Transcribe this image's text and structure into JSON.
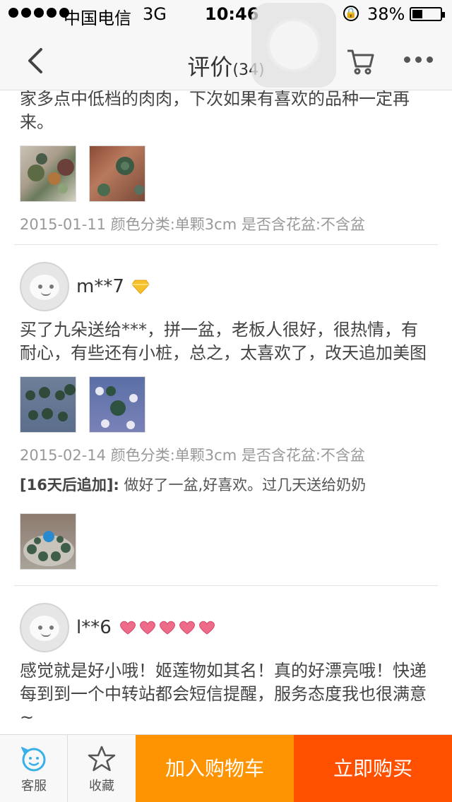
{
  "status_bar": {
    "carrier": "中国电信",
    "network": "3G",
    "time": "10:46",
    "battery_percent": "38%",
    "battery_level": 0.38
  },
  "nav": {
    "title": "评价",
    "count": "(34)"
  },
  "reviews": [
    {
      "text": "家多点中低档的肉肉，下次如果有喜欢的品种一定再来。",
      "meta": "2015-01-11 颜色分类:单颗3cm 是否含花盆:不含盆"
    },
    {
      "username": "m**7",
      "text": "买了九朵送给***，拼一盆，老板人很好，很热情，有耐心，有些还有小桩，总之，太喜欢了，改天追加美图",
      "meta": "2015-02-14 颜色分类:单颗3cm 是否含花盆:不含盆",
      "append_tag": "[16天后追加]:",
      "append_text": " 做好了一盆,好喜欢。过几天送给奶奶"
    },
    {
      "username": "l**6",
      "text": "感觉就是好小哦！姬莲物如其名！真的好漂亮哦！快递每到到一个中转站都会短信提醒，服务态度我也很满意~"
    }
  ],
  "bottom_bar": {
    "service_label": "客服",
    "favorite_label": "收藏",
    "add_to_cart_label": "加入购物车",
    "buy_now_label": "立即购买"
  },
  "colors": {
    "add_to_cart": "#ff9402",
    "buy_now": "#ff5000",
    "service_icon": "#3ab0e8"
  }
}
